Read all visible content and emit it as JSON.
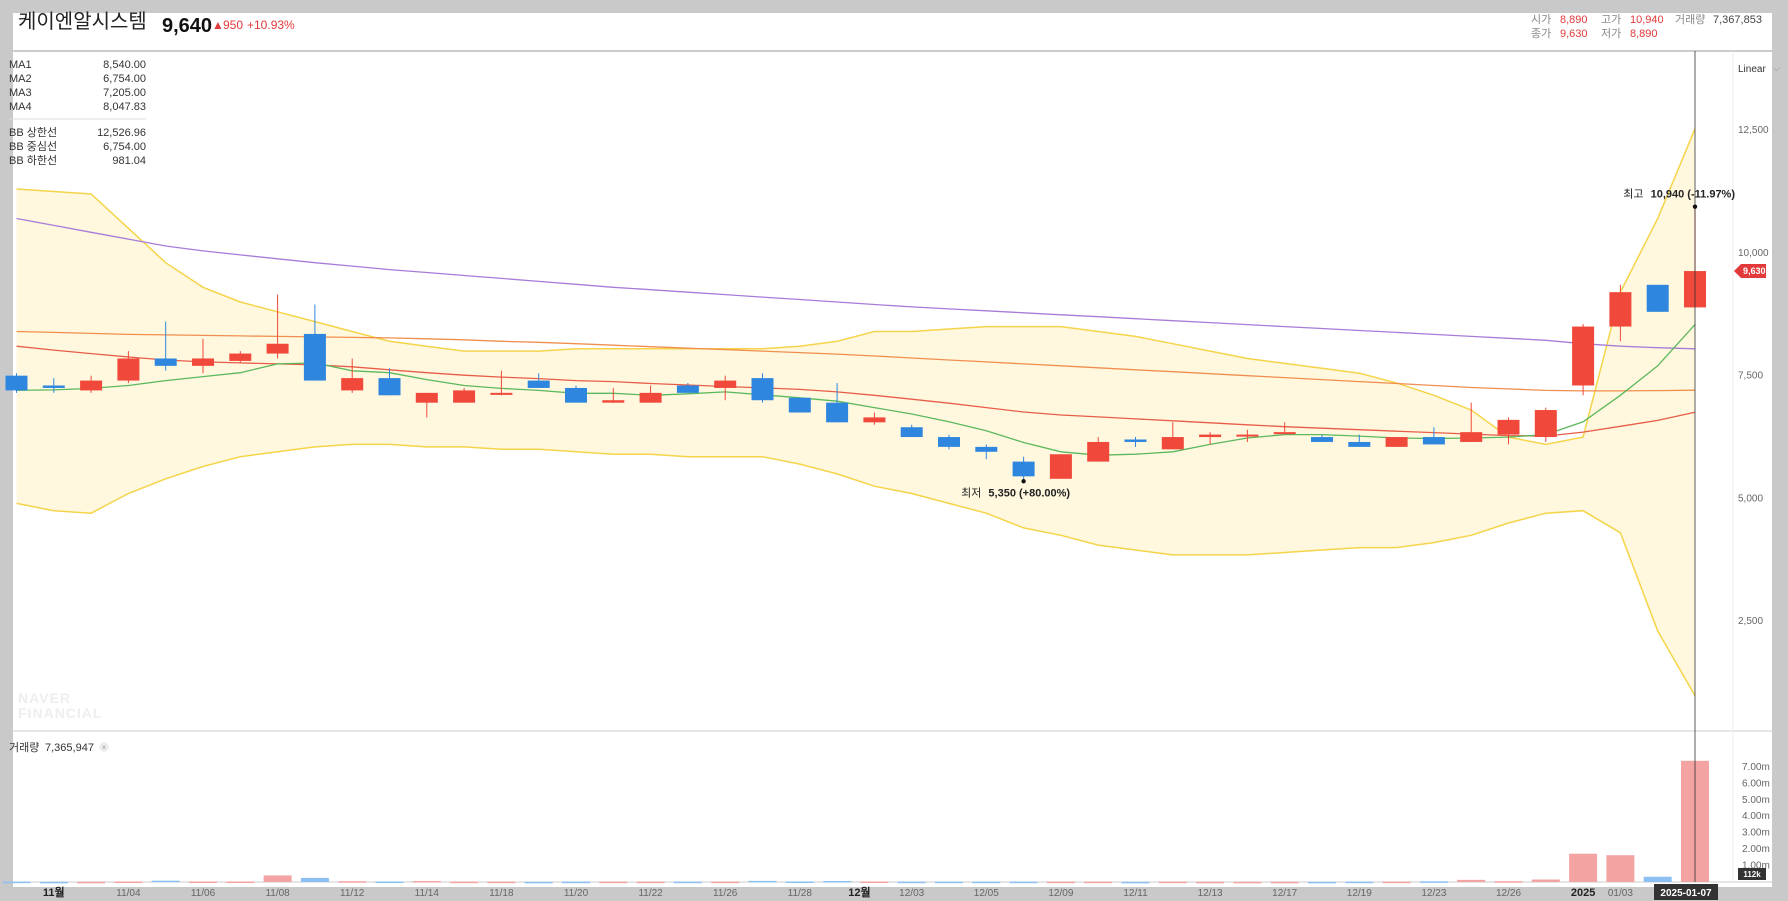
{
  "header": {
    "stock_name": "케이엔알시스템",
    "price": "9,640",
    "change_arrow": "▲",
    "change_abs": "950",
    "change_pct": "+10.93%",
    "stats": {
      "open_label": "시가",
      "open": "8,890",
      "high_label": "고가",
      "high": "10,940",
      "close_label": "종가",
      "close": "9,630",
      "low_label": "저가",
      "low": "8,890",
      "volume_label": "거래량",
      "volume": "7,367,853"
    }
  },
  "scale_selector": "Linear",
  "legend": {
    "ma": [
      {
        "name": "MA1",
        "value": "8,540.00",
        "color": "#5cb85c"
      },
      {
        "name": "MA2",
        "value": "6,754.00",
        "color": "#e85d4a"
      },
      {
        "name": "MA3",
        "value": "7,205.00",
        "color": "#ef8f4f"
      },
      {
        "name": "MA4",
        "value": "8,047.83",
        "color": "#a77cd9"
      }
    ],
    "bb": [
      {
        "name": "BB 상한선",
        "value": "12,526.96",
        "color": "#f0c43a"
      },
      {
        "name": "BB 중심선",
        "value": "6,754.00",
        "color": "#f0c43a"
      },
      {
        "name": "BB 하한선",
        "value": "981.04",
        "color": "#f0c43a"
      }
    ]
  },
  "annotations": {
    "high_label": "최고",
    "high_text": "10,940 (-11.97%)",
    "low_label": "최저",
    "low_text": "5,350 (+80.00%)"
  },
  "current_price_tag": "9,630",
  "volume_panel": {
    "label": "거래량",
    "value": "7,365,947",
    "axis_ticks": [
      "7.00m",
      "6.00m",
      "5.00m",
      "4.00m",
      "3.00m",
      "2.00m",
      "1.00m"
    ],
    "current_tag": "112k"
  },
  "watermark": [
    "NAVER",
    "FINANCIAL"
  ],
  "colors": {
    "up": "#f0483a",
    "down": "#2e86de",
    "bb_fill": "#fff8dc",
    "bb_line": "#f5d44a"
  },
  "chart_data": {
    "type": "candlestick",
    "ylim": [
      0,
      13500
    ],
    "y_ticks": [
      2500,
      5000,
      7500,
      10000,
      12500
    ],
    "y_tick_labels": [
      "2,500",
      "5,000",
      "7,500",
      "10,000",
      "12,500"
    ],
    "x_labels": [
      {
        "i": 1,
        "text": "11월",
        "bold": true
      },
      {
        "i": 3,
        "text": "11/04"
      },
      {
        "i": 5,
        "text": "11/06"
      },
      {
        "i": 7,
        "text": "11/08"
      },
      {
        "i": 9,
        "text": "11/12"
      },
      {
        "i": 11,
        "text": "11/14"
      },
      {
        "i": 13,
        "text": "11/18"
      },
      {
        "i": 15,
        "text": "11/20"
      },
      {
        "i": 17,
        "text": "11/22"
      },
      {
        "i": 19,
        "text": "11/26"
      },
      {
        "i": 21,
        "text": "11/28"
      },
      {
        "i": 22.6,
        "text": "12월",
        "bold": true
      },
      {
        "i": 24,
        "text": "12/03"
      },
      {
        "i": 26,
        "text": "12/05"
      },
      {
        "i": 28,
        "text": "12/09"
      },
      {
        "i": 30,
        "text": "12/11"
      },
      {
        "i": 32,
        "text": "12/13"
      },
      {
        "i": 34,
        "text": "12/17"
      },
      {
        "i": 36,
        "text": "12/19"
      },
      {
        "i": 38,
        "text": "12/23"
      },
      {
        "i": 40,
        "text": "12/26"
      },
      {
        "i": 42,
        "text": "2025",
        "bold": true
      },
      {
        "i": 43,
        "text": "01/03"
      }
    ],
    "current_date_tag": "2025-01-07",
    "candles": [
      {
        "o": 7500,
        "h": 7550,
        "l": 7150,
        "c": 7200
      },
      {
        "o": 7300,
        "h": 7450,
        "l": 7150,
        "c": 7250
      },
      {
        "o": 7200,
        "h": 7500,
        "l": 7150,
        "c": 7400
      },
      {
        "o": 7400,
        "h": 8000,
        "l": 7350,
        "c": 7850
      },
      {
        "o": 7850,
        "h": 8600,
        "l": 7600,
        "c": 7700
      },
      {
        "o": 7700,
        "h": 8250,
        "l": 7550,
        "c": 7850
      },
      {
        "o": 7800,
        "h": 8000,
        "l": 7750,
        "c": 7950
      },
      {
        "o": 7950,
        "h": 9150,
        "l": 7850,
        "c": 8150
      },
      {
        "o": 8350,
        "h": 8950,
        "l": 7400,
        "c": 7400
      },
      {
        "o": 7200,
        "h": 7850,
        "l": 7150,
        "c": 7450
      },
      {
        "o": 7450,
        "h": 7650,
        "l": 7100,
        "c": 7100
      },
      {
        "o": 6950,
        "h": 7150,
        "l": 6650,
        "c": 7150
      },
      {
        "o": 6950,
        "h": 7250,
        "l": 6950,
        "c": 7200
      },
      {
        "o": 7150,
        "h": 7600,
        "l": 7100,
        "c": 7150
      },
      {
        "o": 7400,
        "h": 7550,
        "l": 7250,
        "c": 7250
      },
      {
        "o": 7250,
        "h": 7300,
        "l": 6950,
        "c": 6950
      },
      {
        "o": 6950,
        "h": 7250,
        "l": 6950,
        "c": 7000
      },
      {
        "o": 6950,
        "h": 7300,
        "l": 6950,
        "c": 7150
      },
      {
        "o": 7300,
        "h": 7350,
        "l": 7150,
        "c": 7150
      },
      {
        "o": 7250,
        "h": 7500,
        "l": 7000,
        "c": 7400
      },
      {
        "o": 7450,
        "h": 7550,
        "l": 6950,
        "c": 7000
      },
      {
        "o": 7050,
        "h": 7050,
        "l": 6750,
        "c": 6750
      },
      {
        "o": 6950,
        "h": 7350,
        "l": 6550,
        "c": 6550
      },
      {
        "o": 6550,
        "h": 6750,
        "l": 6500,
        "c": 6650
      },
      {
        "o": 6450,
        "h": 6500,
        "l": 6250,
        "c": 6250
      },
      {
        "o": 6250,
        "h": 6300,
        "l": 6000,
        "c": 6050
      },
      {
        "o": 6050,
        "h": 6100,
        "l": 5800,
        "c": 5950
      },
      {
        "o": 5750,
        "h": 5850,
        "l": 5350,
        "c": 5450
      },
      {
        "o": 5400,
        "h": 5900,
        "l": 5400,
        "c": 5900
      },
      {
        "o": 5750,
        "h": 6250,
        "l": 5750,
        "c": 6150
      },
      {
        "o": 6200,
        "h": 6250,
        "l": 6050,
        "c": 6150
      },
      {
        "o": 6000,
        "h": 6550,
        "l": 6000,
        "c": 6250
      },
      {
        "o": 6250,
        "h": 6350,
        "l": 6100,
        "c": 6300
      },
      {
        "o": 6300,
        "h": 6400,
        "l": 6150,
        "c": 6300
      },
      {
        "o": 6350,
        "h": 6550,
        "l": 6350,
        "c": 6350
      },
      {
        "o": 6250,
        "h": 6300,
        "l": 6150,
        "c": 6150
      },
      {
        "o": 6150,
        "h": 6300,
        "l": 6050,
        "c": 6050
      },
      {
        "o": 6050,
        "h": 6250,
        "l": 6050,
        "c": 6250
      },
      {
        "o": 6250,
        "h": 6450,
        "l": 6100,
        "c": 6100
      },
      {
        "o": 6150,
        "h": 6950,
        "l": 6150,
        "c": 6350
      },
      {
        "o": 6300,
        "h": 6650,
        "l": 6100,
        "c": 6600
      },
      {
        "o": 6250,
        "h": 6850,
        "l": 6150,
        "c": 6800
      },
      {
        "o": 7300,
        "h": 8550,
        "l": 7100,
        "c": 8500
      },
      {
        "o": 8500,
        "h": 9350,
        "l": 8200,
        "c": 9200
      },
      {
        "o": 9350,
        "h": 9350,
        "l": 8800,
        "c": 8800
      },
      {
        "o": 8890,
        "h": 10940,
        "l": 8890,
        "c": 9630
      }
    ],
    "ma1": [
      7200,
      7210,
      7240,
      7300,
      7400,
      7480,
      7560,
      7740,
      7760,
      7600,
      7560,
      7420,
      7300,
      7240,
      7200,
      7140,
      7140,
      7100,
      7130,
      7170,
      7110,
      7050,
      6980,
      6850,
      6720,
      6560,
      6380,
      6140,
      5950,
      5880,
      5900,
      5950,
      6100,
      6230,
      6300,
      6300,
      6270,
      6230,
      6220,
      6230,
      6250,
      6300,
      6560,
      7100,
      7700,
      8540
    ],
    "ma2": [
      8100,
      8020,
      7950,
      7880,
      7820,
      7780,
      7760,
      7740,
      7720,
      7680,
      7620,
      7560,
      7510,
      7470,
      7440,
      7400,
      7380,
      7340,
      7310,
      7280,
      7250,
      7220,
      7170,
      7100,
      7020,
      6940,
      6850,
      6760,
      6700,
      6660,
      6620,
      6580,
      6540,
      6500,
      6460,
      6430,
      6400,
      6370,
      6340,
      6310,
      6280,
      6270,
      6350,
      6470,
      6590,
      6754
    ],
    "ma3": [
      8400,
      8380,
      8360,
      8340,
      8330,
      8320,
      8310,
      8300,
      8290,
      8280,
      8270,
      8250,
      8230,
      8200,
      8180,
      8150,
      8120,
      8090,
      8060,
      8030,
      8000,
      7970,
      7940,
      7900,
      7860,
      7820,
      7780,
      7740,
      7700,
      7660,
      7620,
      7580,
      7540,
      7500,
      7460,
      7420,
      7380,
      7340,
      7300,
      7260,
      7230,
      7200,
      7190,
      7190,
      7195,
      7205
    ],
    "ma4": [
      10700,
      10560,
      10420,
      10280,
      10140,
      10040,
      9960,
      9880,
      9800,
      9730,
      9660,
      9600,
      9540,
      9480,
      9420,
      9360,
      9300,
      9250,
      9200,
      9150,
      9100,
      9050,
      9000,
      8950,
      8900,
      8860,
      8820,
      8780,
      8740,
      8700,
      8660,
      8620,
      8580,
      8540,
      8500,
      8460,
      8420,
      8380,
      8340,
      8300,
      8260,
      8220,
      8150,
      8100,
      8070,
      8047.83
    ],
    "bb_upper": [
      11300,
      11250,
      11200,
      10500,
      9800,
      9300,
      9000,
      8800,
      8600,
      8400,
      8200,
      8100,
      8000,
      8000,
      8000,
      8050,
      8050,
      8050,
      8050,
      8050,
      8050,
      8100,
      8200,
      8400,
      8400,
      8450,
      8500,
      8500,
      8500,
      8400,
      8300,
      8150,
      8000,
      7850,
      7750,
      7650,
      7550,
      7350,
      7100,
      6800,
      6250,
      6100,
      6250,
      9200,
      10700,
      12526.96
    ],
    "bb_lower": [
      4900,
      4750,
      4700,
      5100,
      5400,
      5650,
      5850,
      5950,
      6050,
      6100,
      6100,
      6050,
      6050,
      6000,
      6000,
      5950,
      5900,
      5900,
      5850,
      5850,
      5850,
      5700,
      5500,
      5250,
      5100,
      4900,
      4700,
      4400,
      4250,
      4050,
      3950,
      3850,
      3850,
      3850,
      3900,
      3950,
      4000,
      4000,
      4100,
      4250,
      4500,
      4700,
      4750,
      4300,
      2300,
      981.04
    ],
    "volume_m": [
      0.02,
      0.01,
      0.01,
      0.03,
      0.08,
      0.03,
      0.03,
      0.4,
      0.25,
      0.05,
      0.03,
      0.06,
      0.02,
      0.02,
      0.01,
      0.02,
      0.02,
      0.02,
      0.02,
      0.02,
      0.07,
      0.03,
      0.06,
      0.03,
      0.02,
      0.02,
      0.02,
      0.02,
      0.02,
      0.02,
      0.01,
      0.02,
      0.01,
      0.01,
      0.01,
      0.01,
      0.02,
      0.02,
      0.04,
      0.13,
      0.05,
      0.15,
      1.72,
      1.63,
      0.32,
      7.37
    ]
  }
}
